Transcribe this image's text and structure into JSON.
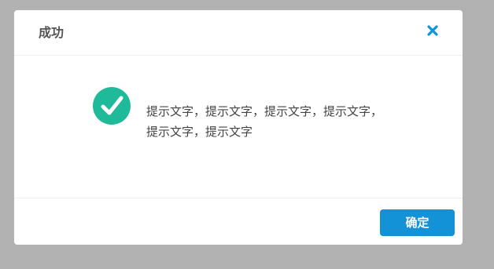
{
  "dialog": {
    "title": "成功",
    "close_icon": "close-icon",
    "message": "提示文字，提示文字，提示文字，提示文字，提示文字，提示文字",
    "status_icon": "check-circle-icon",
    "confirm_label": "确定"
  },
  "colors": {
    "overlay": "#b2b2b2",
    "dialog_bg": "#ffffff",
    "accent": "#1492d8",
    "success": "#1fba99",
    "title_text": "#555555",
    "message_text": "#444444"
  }
}
